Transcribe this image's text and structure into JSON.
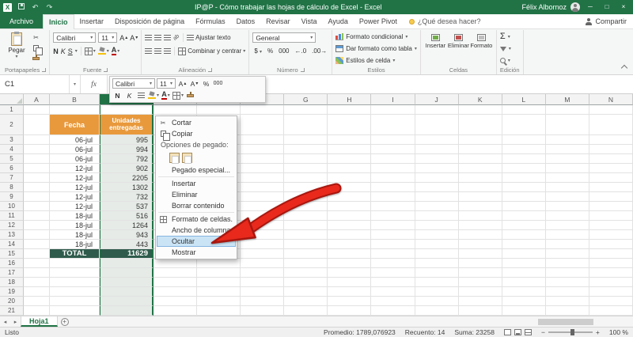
{
  "colors": {
    "excel_green": "#217346",
    "header_orange": "#E8993C",
    "total_green": "#2F5B4C",
    "arrow_red": "#E8291C",
    "menu_highlight": "#CBE4F5"
  },
  "icons": {
    "scissors-icon": "✂",
    "copy-icon": "double-rect",
    "format-painter-icon": "brush",
    "paste-icon": "clipboard",
    "borders-icon": "grid",
    "fill-color-icon": "bucket",
    "font-color-icon": "A-red",
    "autosum-icon": "Σ",
    "sort-filter-icon": "funnel",
    "find-select-icon": "magnifier",
    "new-sheet-icon": "+",
    "minimize-icon": "─",
    "maximize-icon": "□",
    "close-icon": "×",
    "lightbulb-icon": "bulb",
    "share-icon": "person",
    "format-cells-icon": "dialog-grid"
  },
  "titlebar": {
    "title": "IP@P - Cómo trabajar las hojas de cálculo de Excel - Excel",
    "user_name": "Félix Albornoz"
  },
  "ribbon_tabs": {
    "file": "Archivo",
    "items": [
      "Inicio",
      "Insertar",
      "Disposición de página",
      "Fórmulas",
      "Datos",
      "Revisar",
      "Vista",
      "Ayuda",
      "Power Pivot"
    ],
    "active": "Inicio",
    "tell_me": "¿Qué desea hacer?",
    "share": "Compartir"
  },
  "ribbon": {
    "clipboard": {
      "paste_label": "Pegar",
      "group_label": "Portapapeles"
    },
    "font": {
      "font_name": "Calibri",
      "font_size": "11",
      "bold": "N",
      "italic": "K",
      "underline": "S",
      "group_label": "Fuente"
    },
    "alignment": {
      "wrap_text": "Ajustar texto",
      "merge_center": "Combinar y centrar",
      "group_label": "Alineación"
    },
    "number": {
      "format": "General",
      "group_label": "Número"
    },
    "styles": {
      "conditional": "Formato condicional",
      "format_table": "Dar formato como tabla",
      "cell_styles": "Estilos de celda",
      "group_label": "Estilos"
    },
    "cells": {
      "insert": "Insertar",
      "delete": "Eliminar",
      "format": "Formato",
      "group_label": "Celdas"
    },
    "editing": {
      "autosum": "Σ",
      "group_label": "Edición"
    }
  },
  "formula_bar": {
    "name_box": "C1",
    "fx_label": "fx"
  },
  "mini_toolbar": {
    "font_name": "Calibri",
    "font_size": "11",
    "bold": "N",
    "italic": "K"
  },
  "context_menu": {
    "items": [
      {
        "type": "item",
        "label": "Cortar",
        "icon": "scissors-icon"
      },
      {
        "type": "item",
        "label": "Copiar",
        "icon": "copy-icon"
      },
      {
        "type": "group-label",
        "label": "Opciones de pegado:"
      },
      {
        "type": "paste-options"
      },
      {
        "type": "item",
        "label": "Pegado especial..."
      },
      {
        "type": "separator"
      },
      {
        "type": "item",
        "label": "Insertar"
      },
      {
        "type": "item",
        "label": "Eliminar"
      },
      {
        "type": "item",
        "label": "Borrar contenido"
      },
      {
        "type": "separator"
      },
      {
        "type": "item",
        "label": "Formato de celdas...",
        "icon": "format-cells-icon"
      },
      {
        "type": "item",
        "label": "Ancho de columna..."
      },
      {
        "type": "item",
        "label": "Ocultar",
        "highlighted": true
      },
      {
        "type": "item",
        "label": "Mostrar"
      }
    ]
  },
  "sheet": {
    "columns": [
      "A",
      "B",
      "C",
      "D",
      "E",
      "F",
      "G",
      "H",
      "I",
      "J",
      "K",
      "L",
      "M",
      "N"
    ],
    "selected_column": "C",
    "active_cell": "C1",
    "row_count": 21,
    "table": {
      "fecha_header": "Fecha",
      "unidades_header": "Unidades entregadas",
      "rows": [
        {
          "fecha": "06-jul",
          "unidades": "995"
        },
        {
          "fecha": "06-jul",
          "unidades": "994"
        },
        {
          "fecha": "06-jul",
          "unidades": "792"
        },
        {
          "fecha": "12-jul",
          "unidades": "902"
        },
        {
          "fecha": "12-jul",
          "unidades": "2205"
        },
        {
          "fecha": "12-jul",
          "unidades": "1302"
        },
        {
          "fecha": "12-jul",
          "unidades": "732"
        },
        {
          "fecha": "12-jul",
          "unidades": "537"
        },
        {
          "fecha": "18-jul",
          "unidades": "516"
        },
        {
          "fecha": "18-jul",
          "unidades": "1264"
        },
        {
          "fecha": "18-jul",
          "unidades": "943"
        },
        {
          "fecha": "18-jul",
          "unidades": "443"
        }
      ],
      "total_label": "TOTAL",
      "total_value": "11629"
    }
  },
  "sheet_tabs": {
    "active_sheet": "Hoja1"
  },
  "status_bar": {
    "mode": "Listo",
    "promedio": "Promedio: 1789,076923",
    "recuento": "Recuento: 14",
    "suma": "Suma: 23258",
    "zoom": "100 %"
  }
}
